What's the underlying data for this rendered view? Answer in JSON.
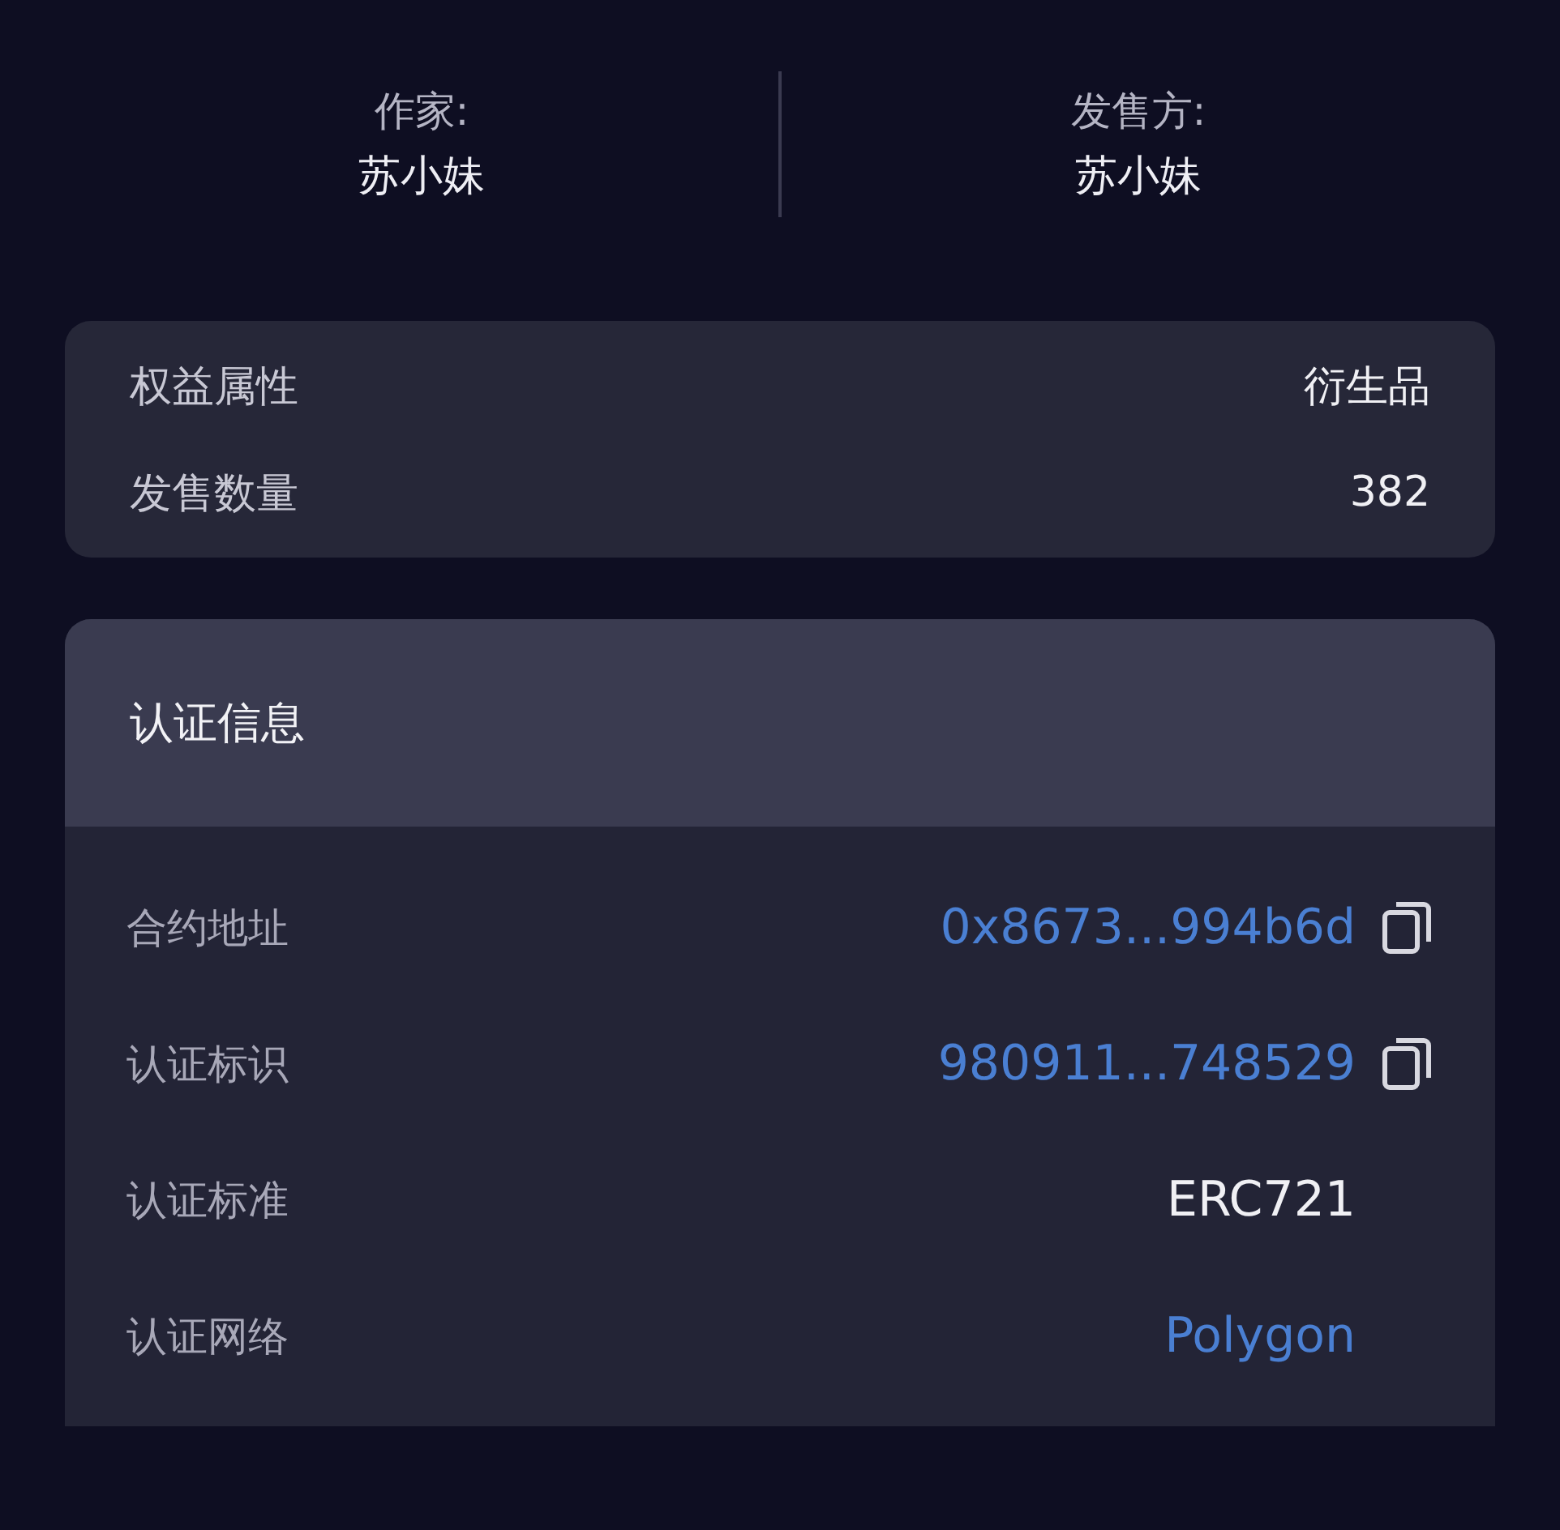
{
  "creators": [
    {
      "label": "作家:",
      "value": "苏小妹"
    },
    {
      "label": "发售方:",
      "value": "苏小妹"
    }
  ],
  "attributes": [
    {
      "label": "权益属性",
      "value": "衍生品"
    },
    {
      "label": "发售数量",
      "value": "382"
    }
  ],
  "certification": {
    "title": "认证信息",
    "rows": [
      {
        "label": "合约地址",
        "value": "0x8673...994b6d",
        "link": true,
        "copyable": true
      },
      {
        "label": "认证标识",
        "value": "980911...748529",
        "link": true,
        "copyable": true
      },
      {
        "label": "认证标准",
        "value": "ERC721",
        "link": false,
        "copyable": false
      },
      {
        "label": "认证网络",
        "value": "Polygon",
        "link": true,
        "copyable": false
      }
    ]
  }
}
